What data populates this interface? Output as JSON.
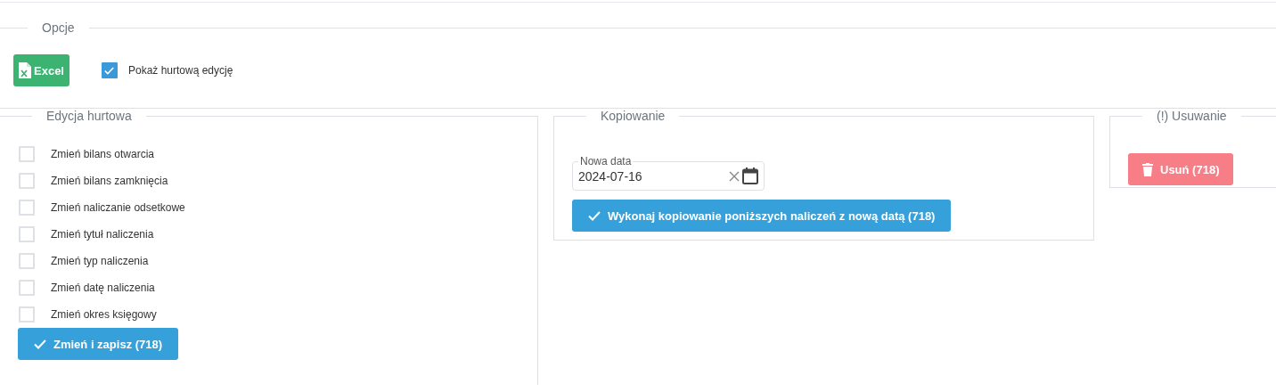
{
  "options": {
    "title": "Opcje",
    "excel_button": "Excel",
    "bulk_toggle": {
      "label": "Pokaż hurtową edycję",
      "checked": true
    }
  },
  "bulk_edit": {
    "title": "Edycja hurtowa",
    "items": [
      {
        "label": "Zmień bilans otwarcia",
        "checked": false
      },
      {
        "label": "Zmień bilans zamknięcia",
        "checked": false
      },
      {
        "label": "Zmień naliczanie odsetkowe",
        "checked": false
      },
      {
        "label": "Zmień tytuł naliczenia",
        "checked": false
      },
      {
        "label": "Zmień typ naliczenia",
        "checked": false
      },
      {
        "label": "Zmień datę naliczenia",
        "checked": false
      },
      {
        "label": "Zmień okres księgowy",
        "checked": false
      }
    ],
    "save_button": "Zmień i zapisz (718)"
  },
  "copying": {
    "title": "Kopiowanie",
    "date_field": {
      "label": "Nowa data",
      "value": "2024-07-16"
    },
    "copy_button": "Wykonaj kopiowanie poniższych naliczeń z nową datą (718)"
  },
  "removal": {
    "title": "(!) Usuwanie",
    "delete_button": "Usuń (718)"
  }
}
